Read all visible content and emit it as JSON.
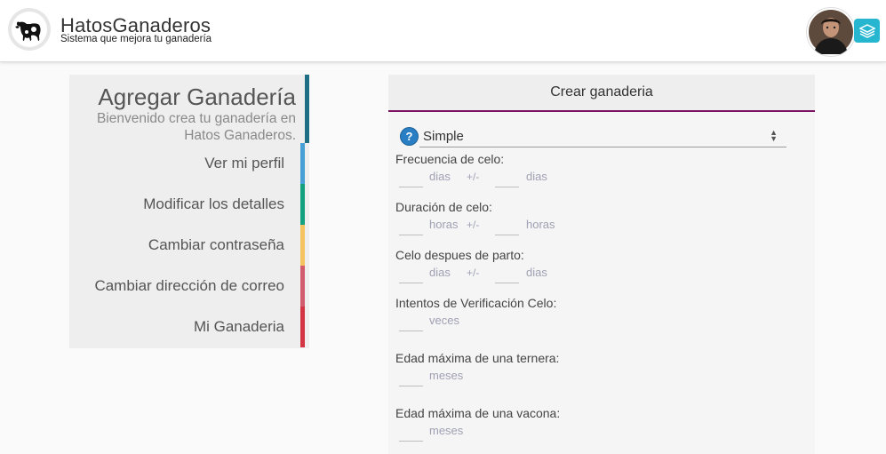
{
  "header": {
    "brand_title": "HatosGanaderos",
    "brand_subtitle": "Sistema que mejora tu ganadería",
    "logo_icon": "cow-icon",
    "avatar_icon": "user-avatar",
    "layers_icon": "layers-icon",
    "accent_color": "#27b6cf"
  },
  "menu": {
    "title": "Agregar Ganadería",
    "subtitle": "Bienvenido crea tu ganadería en Hatos Ganaderos.",
    "items": [
      {
        "label": "Ver mi perfil",
        "color": "#46a0d6"
      },
      {
        "label": "Modificar los detalles",
        "color": "#13a07f"
      },
      {
        "label": "Cambiar contraseña",
        "color": "#f5c35f"
      },
      {
        "label": "Cambiar dirección de correo",
        "color": "#d25b6e"
      },
      {
        "label": "Mi Ganaderia",
        "color": "#d43444"
      }
    ],
    "head_color": "#1e6e85"
  },
  "form": {
    "title": "Crear ganaderia",
    "title_border_color": "#7e1466",
    "type_select": {
      "value": "Simple"
    },
    "help_icon": "question-circle-icon",
    "fields": [
      {
        "label": "Frecuencia de celo:",
        "unit1": "dias",
        "separator": "+/-",
        "unit2": "dias"
      },
      {
        "label": "Duración de celo:",
        "unit1": "horas",
        "separator": "+/-",
        "unit2": "horas"
      },
      {
        "label": "Celo despues de parto:",
        "unit1": "dias",
        "separator": "+/-",
        "unit2": "dias"
      },
      {
        "label": "Intentos de Verificación Celo:",
        "unit1": "veces"
      },
      {
        "label": "Edad máxima de una ternera:",
        "unit1": "meses"
      },
      {
        "label": "Edad máxima de una vacona:",
        "unit1": "meses"
      }
    ]
  }
}
